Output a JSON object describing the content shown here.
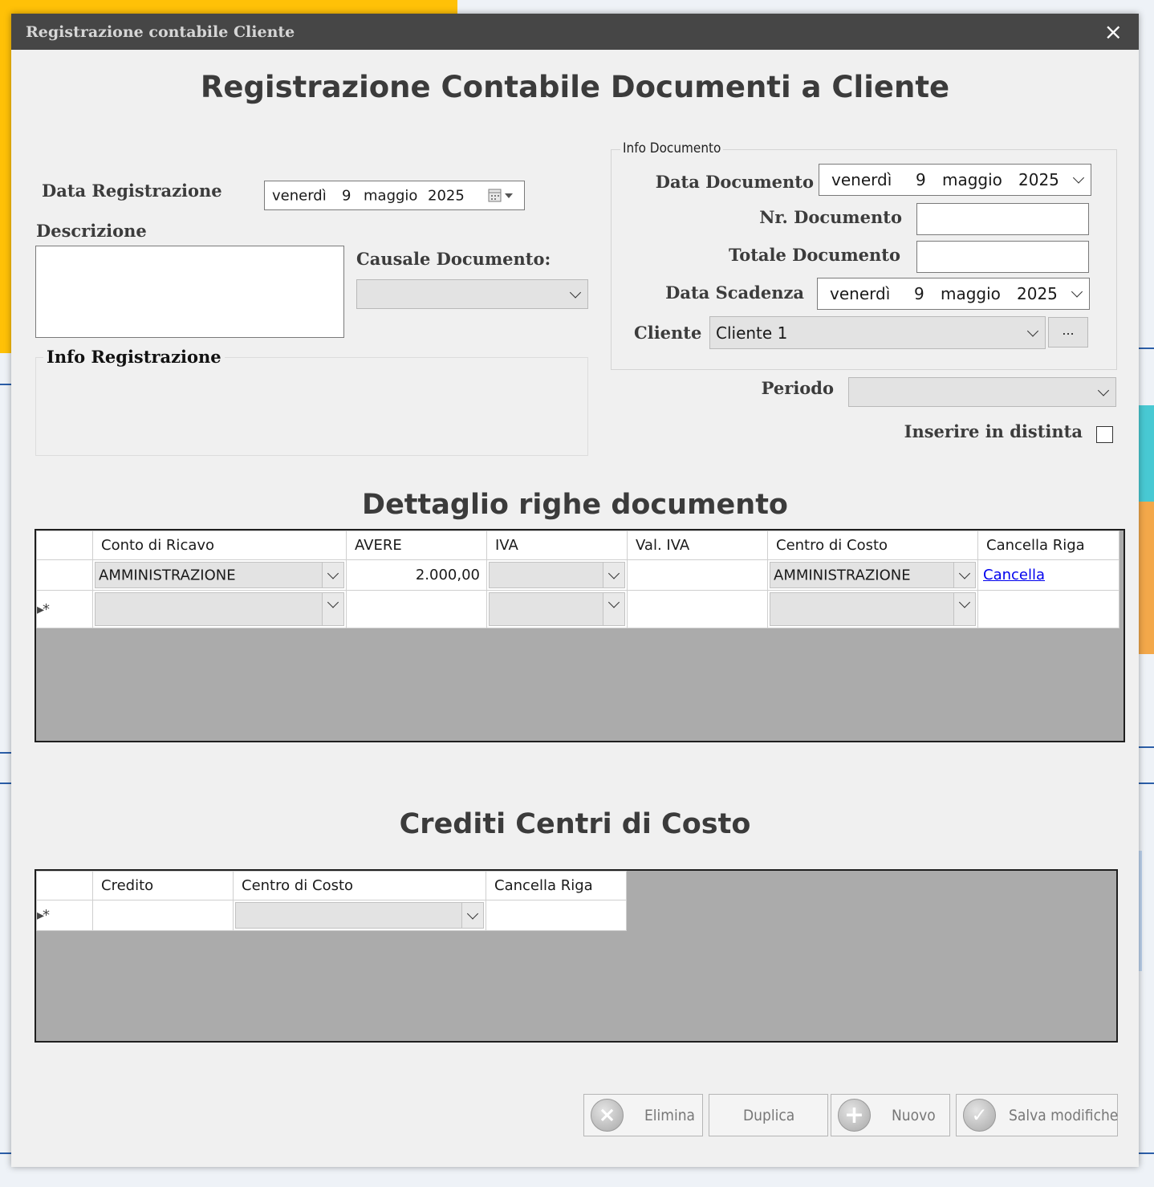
{
  "window": {
    "title": "Registrazione contabile Cliente",
    "close_glyph": "×",
    "heading": "Registrazione Contabile Documenti a Cliente"
  },
  "left": {
    "data_registrazione_label": "Data Registrazione",
    "data_registrazione": {
      "day_name": "venerdì",
      "day": "9",
      "month": "maggio",
      "year": "2025"
    },
    "descrizione_label": "Descrizione",
    "descrizione_value": "",
    "causale_label": "Causale Documento:",
    "causale_value": "",
    "info_registrazione_label": "Info Registrazione"
  },
  "info_documento": {
    "legend": "Info Documento",
    "data_documento_label": "Data Documento",
    "data_documento": {
      "day_name": "venerdì",
      "day": "9",
      "month": "maggio",
      "year": "2025"
    },
    "nr_documento_label": "Nr. Documento",
    "nr_documento_value": "",
    "totale_documento_label": "Totale Documento",
    "totale_documento_value": "",
    "data_scadenza_label": "Data Scadenza",
    "data_scadenza": {
      "day_name": "venerdì",
      "day": "9",
      "month": "maggio",
      "year": "2025"
    },
    "cliente_label": "Cliente",
    "cliente_value": "Cliente 1",
    "cliente_browse": "..."
  },
  "periodo_label": "Periodo",
  "periodo_value": "",
  "inserire_distinta_label": "Inserire in distinta",
  "dettaglio": {
    "heading": "Dettaglio righe documento",
    "columns": [
      "Conto di Ricavo",
      "AVERE",
      "IVA",
      "Val. IVA",
      "Centro di Costo",
      "Cancella Riga"
    ],
    "row1": {
      "conto": "AMMINISTRAZIONE",
      "avere": "2.000,00",
      "iva": "",
      "val_iva": "",
      "centro": "AMMINISTRAZIONE",
      "cancella": "Cancella"
    },
    "new_row_marker": "▸*"
  },
  "crediti": {
    "heading": "Crediti Centri di Costo",
    "columns": [
      "Credito",
      "Centro di Costo",
      "Cancella Riga"
    ],
    "new_row_marker": "▸*"
  },
  "buttons": {
    "elimina": "Elimina",
    "duplica": "Duplica",
    "nuovo": "Nuovo",
    "salva": "Salva modifiche"
  }
}
